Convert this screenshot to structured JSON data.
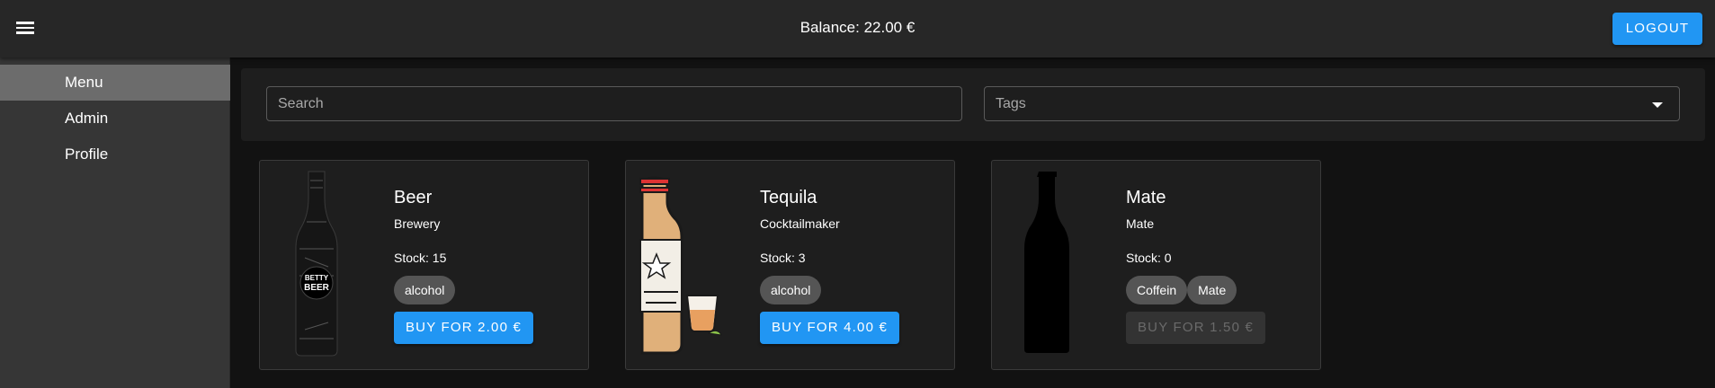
{
  "header": {
    "balance": "Balance: 22.00 €",
    "logout_label": "LOGOUT"
  },
  "sidebar": {
    "items": [
      {
        "label": "Menu",
        "active": true
      },
      {
        "label": "Admin",
        "active": false
      },
      {
        "label": "Profile",
        "active": false
      }
    ]
  },
  "filters": {
    "search_placeholder": "Search",
    "tags_label": "Tags"
  },
  "products": [
    {
      "name": "Beer",
      "maker": "Brewery",
      "stock": "Stock: 15",
      "tags": [
        "alcohol"
      ],
      "buy_label": "BUY FOR 2.00 €",
      "available": true,
      "image_icon": "beer-bottle-icon",
      "brand_text": "BETTY BEER"
    },
    {
      "name": "Tequila",
      "maker": "Cocktailmaker",
      "stock": "Stock: 3",
      "tags": [
        "alcohol"
      ],
      "buy_label": "BUY FOR 4.00 €",
      "available": true,
      "image_icon": "tequila-bottle-icon"
    },
    {
      "name": "Mate",
      "maker": "Mate",
      "stock": "Stock: 0",
      "tags": [
        "Coffein",
        "Mate"
      ],
      "buy_label": "BUY FOR 1.50 €",
      "available": false,
      "image_icon": "mate-bottle-icon"
    }
  ],
  "colors": {
    "accent": "#2196f3",
    "appbar": "#272727",
    "drawer": "#363636",
    "drawer_active": "#6c6c6c",
    "background": "#121212",
    "card": "#1e1e1e"
  }
}
